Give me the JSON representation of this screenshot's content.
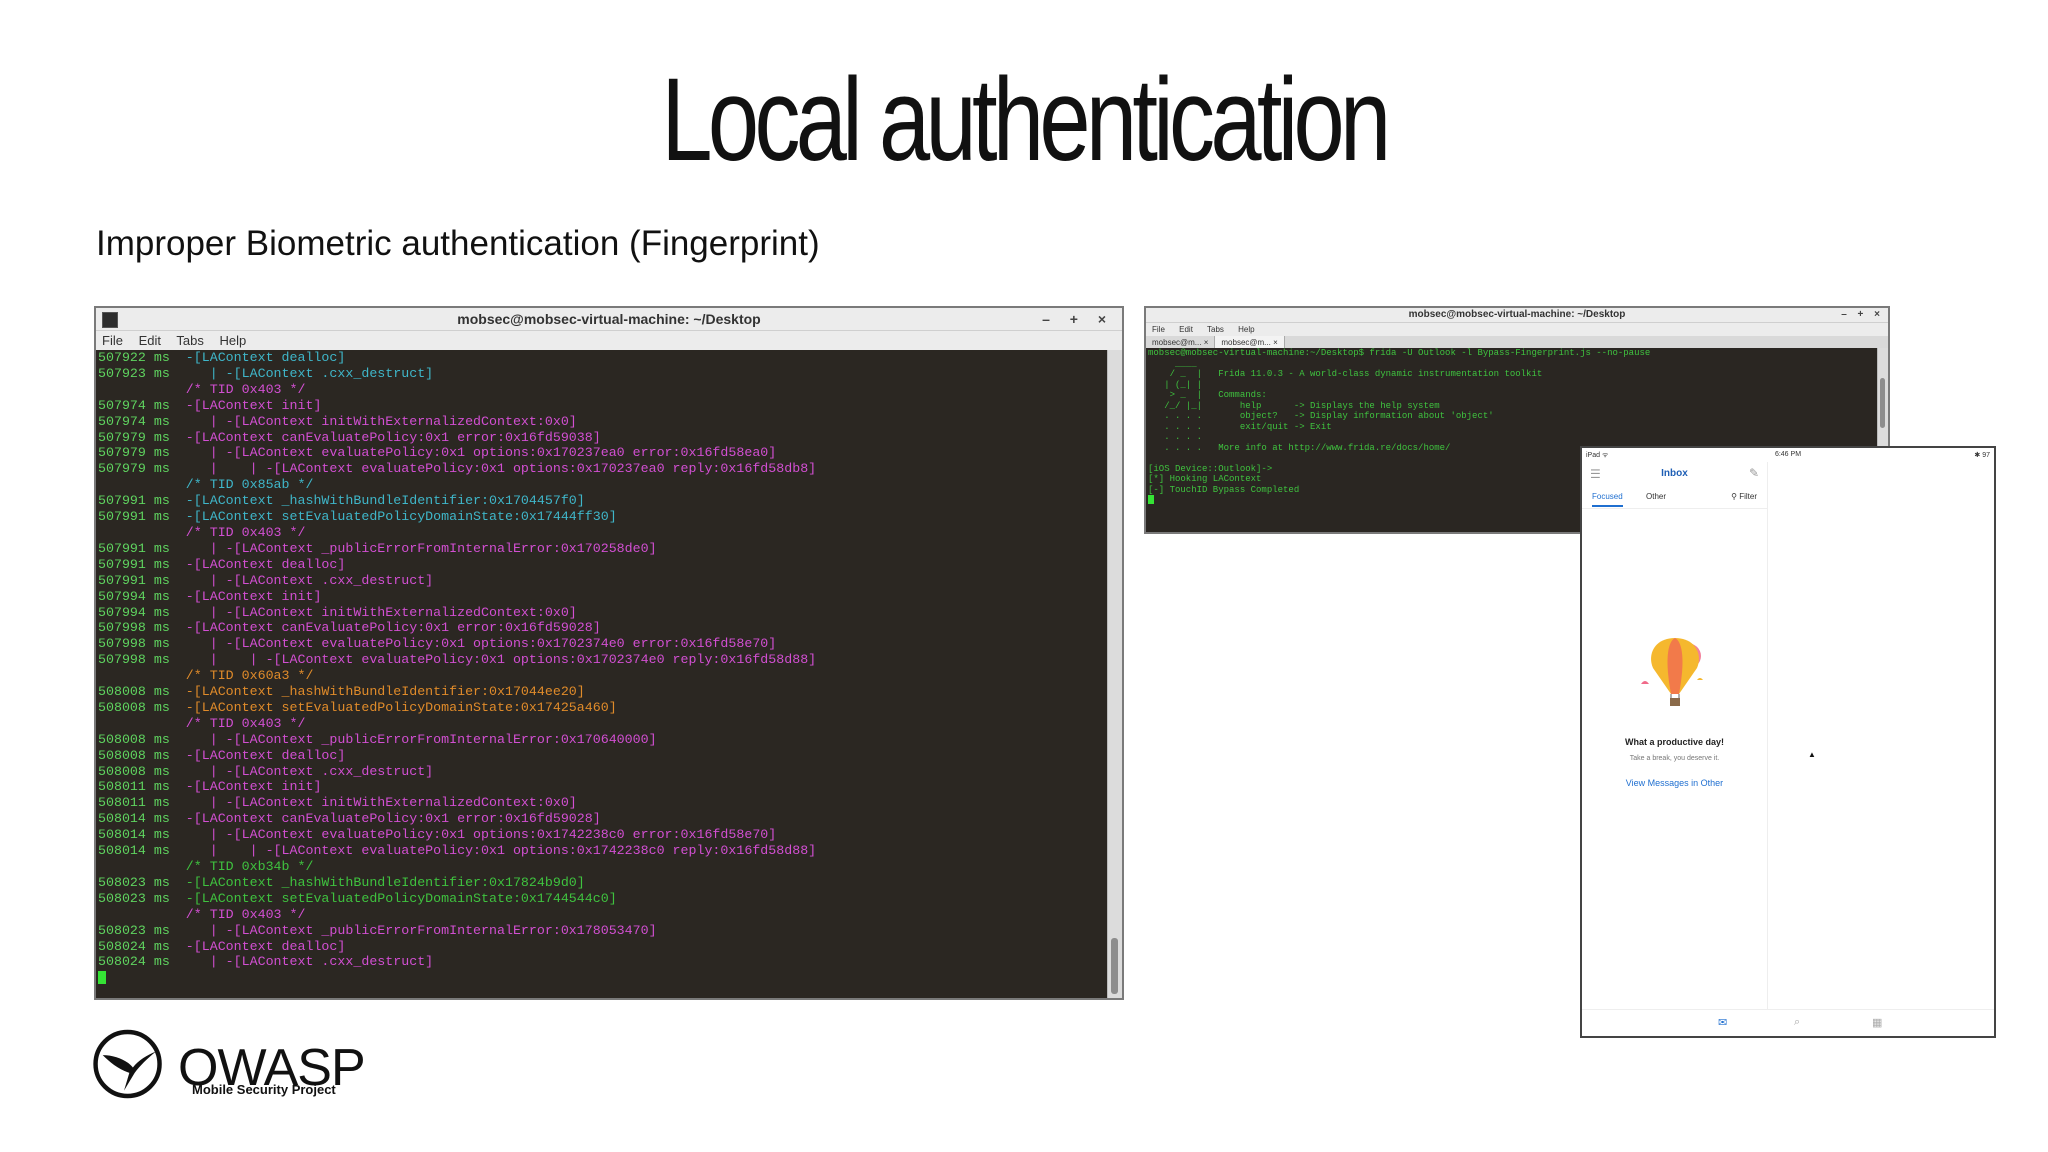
{
  "slide": {
    "title": "Local authentication",
    "subtitle": "Improper Biometric authentication (Fingerprint)"
  },
  "main_terminal": {
    "title": "mobsec@mobsec-virtual-machine: ~/Desktop",
    "window_controls": "– + ×",
    "menu": [
      "File",
      "Edit",
      "Tabs",
      "Help"
    ],
    "lines": [
      {
        "ts": "507922 ms",
        "text": "  -[LAContext dealloc]",
        "color": "cyan"
      },
      {
        "ts": "507923 ms",
        "text": "     | -[LAContext .cxx_destruct]",
        "color": "cyan"
      },
      {
        "ts": "",
        "text": "  /* TID 0x403 */",
        "color": "magenta"
      },
      {
        "ts": "507974 ms",
        "text": "  -[LAContext init]",
        "color": "magenta"
      },
      {
        "ts": "507974 ms",
        "text": "     | -[LAContext initWithExternalizedContext:0x0]",
        "color": "magenta"
      },
      {
        "ts": "507979 ms",
        "text": "  -[LAContext canEvaluatePolicy:0x1 error:0x16fd59038]",
        "color": "magenta"
      },
      {
        "ts": "507979 ms",
        "text": "     | -[LAContext evaluatePolicy:0x1 options:0x170237ea0 error:0x16fd58ea0]",
        "color": "magenta"
      },
      {
        "ts": "507979 ms",
        "text": "     |    | -[LAContext evaluatePolicy:0x1 options:0x170237ea0 reply:0x16fd58db8]",
        "color": "magenta"
      },
      {
        "ts": "",
        "text": "  /* TID 0x85ab */",
        "color": "cyan"
      },
      {
        "ts": "507991 ms",
        "text": "  -[LAContext _hashWithBundleIdentifier:0x1704457f0]",
        "color": "cyan"
      },
      {
        "ts": "507991 ms",
        "text": "  -[LAContext setEvaluatedPolicyDomainState:0x17444ff30]",
        "color": "cyan"
      },
      {
        "ts": "",
        "text": "  /* TID 0x403 */",
        "color": "magenta"
      },
      {
        "ts": "507991 ms",
        "text": "     | -[LAContext _publicErrorFromInternalError:0x170258de0]",
        "color": "magenta"
      },
      {
        "ts": "507991 ms",
        "text": "  -[LAContext dealloc]",
        "color": "magenta"
      },
      {
        "ts": "507991 ms",
        "text": "     | -[LAContext .cxx_destruct]",
        "color": "magenta"
      },
      {
        "ts": "507994 ms",
        "text": "  -[LAContext init]",
        "color": "magenta"
      },
      {
        "ts": "507994 ms",
        "text": "     | -[LAContext initWithExternalizedContext:0x0]",
        "color": "magenta"
      },
      {
        "ts": "507998 ms",
        "text": "  -[LAContext canEvaluatePolicy:0x1 error:0x16fd59028]",
        "color": "magenta"
      },
      {
        "ts": "507998 ms",
        "text": "     | -[LAContext evaluatePolicy:0x1 options:0x1702374e0 error:0x16fd58e70]",
        "color": "magenta"
      },
      {
        "ts": "507998 ms",
        "text": "     |    | -[LAContext evaluatePolicy:0x1 options:0x1702374e0 reply:0x16fd58d88]",
        "color": "magenta"
      },
      {
        "ts": "",
        "text": "  /* TID 0x60a3 */",
        "color": "orange"
      },
      {
        "ts": "508008 ms",
        "text": "  -[LAContext _hashWithBundleIdentifier:0x17044ee20]",
        "color": "orange"
      },
      {
        "ts": "508008 ms",
        "text": "  -[LAContext setEvaluatedPolicyDomainState:0x17425a460]",
        "color": "orange"
      },
      {
        "ts": "",
        "text": "  /* TID 0x403 */",
        "color": "magenta"
      },
      {
        "ts": "508008 ms",
        "text": "     | -[LAContext _publicErrorFromInternalError:0x170640000]",
        "color": "magenta"
      },
      {
        "ts": "508008 ms",
        "text": "  -[LAContext dealloc]",
        "color": "magenta"
      },
      {
        "ts": "508008 ms",
        "text": "     | -[LAContext .cxx_destruct]",
        "color": "magenta"
      },
      {
        "ts": "508011 ms",
        "text": "  -[LAContext init]",
        "color": "magenta"
      },
      {
        "ts": "508011 ms",
        "text": "     | -[LAContext initWithExternalizedContext:0x0]",
        "color": "magenta"
      },
      {
        "ts": "508014 ms",
        "text": "  -[LAContext canEvaluatePolicy:0x1 error:0x16fd59028]",
        "color": "magenta"
      },
      {
        "ts": "508014 ms",
        "text": "     | -[LAContext evaluatePolicy:0x1 options:0x1742238c0 error:0x16fd58e70]",
        "color": "magenta"
      },
      {
        "ts": "508014 ms",
        "text": "     |    | -[LAContext evaluatePolicy:0x1 options:0x1742238c0 reply:0x16fd58d88]",
        "color": "magenta"
      },
      {
        "ts": "",
        "text": "  /* TID 0xb34b */",
        "color": "green"
      },
      {
        "ts": "508023 ms",
        "text": "  -[LAContext _hashWithBundleIdentifier:0x17824b9d0]",
        "color": "green"
      },
      {
        "ts": "508023 ms",
        "text": "  -[LAContext setEvaluatedPolicyDomainState:0x1744544c0]",
        "color": "green"
      },
      {
        "ts": "",
        "text": "  /* TID 0x403 */",
        "color": "magenta"
      },
      {
        "ts": "508023 ms",
        "text": "     | -[LAContext _publicErrorFromInternalError:0x178053470]",
        "color": "magenta"
      },
      {
        "ts": "508024 ms",
        "text": "  -[LAContext dealloc]",
        "color": "magenta"
      },
      {
        "ts": "508024 ms",
        "text": "     | -[LAContext .cxx_destruct]",
        "color": "magenta"
      }
    ]
  },
  "frida_terminal": {
    "title": "mobsec@mobsec-virtual-machine: ~/Desktop",
    "window_controls": "– + ×",
    "menu": [
      "File",
      "Edit",
      "Tabs",
      "Help"
    ],
    "tabs": [
      "mobsec@m...",
      "mobsec@m..."
    ],
    "lines": [
      "mobsec@mobsec-virtual-machine:~/Desktop$ frida -U Outlook -l Bypass-Fingerprint.js --no-pause",
      "     ____",
      "    / _  |   Frida 11.0.3 - A world-class dynamic instrumentation toolkit",
      "   | (_| |",
      "    > _  |   Commands:",
      "   /_/ |_|       help      -> Displays the help system",
      "   . . . .       object?   -> Display information about 'object'",
      "   . . . .       exit/quit -> Exit",
      "   . . . .",
      "   . . . .   More info at http://www.frida.re/docs/home/",
      "",
      "[iOS Device::Outlook]->",
      "[*] Hooking LAContext",
      "[-] TouchID Bypass Completed"
    ]
  },
  "ipad": {
    "status_left": "iPad ᯤ",
    "status_time": "6:46 PM",
    "status_right": "✱ 97",
    "nav_title": "Inbox",
    "tab_focused": "Focused",
    "tab_other": "Other",
    "filter": "Filter",
    "empty_title": "What a productive day!",
    "empty_sub": "Take a break, you deserve it.",
    "empty_link": "View Messages in Other"
  },
  "logo": {
    "name": "OWASP",
    "sub": "Mobile Security Project"
  },
  "colors": {
    "magenta": "#d24fd2",
    "cyan": "#3fb6c9",
    "green": "#3fc23f",
    "orange": "#e08b2a",
    "timestamp": "#5fd35f",
    "terminal_bg": "#2b2722"
  }
}
